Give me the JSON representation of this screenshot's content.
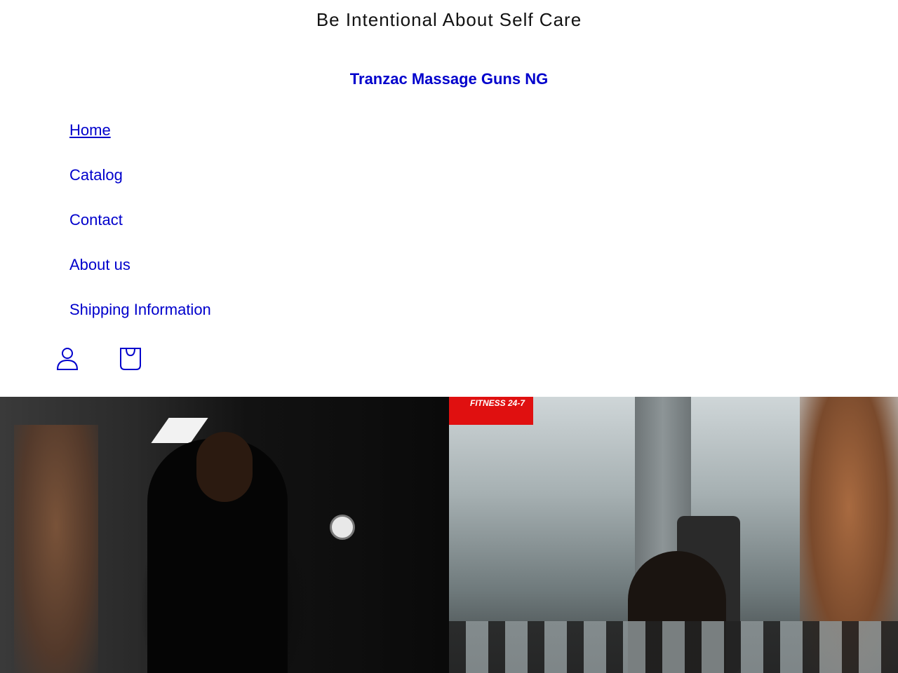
{
  "announcement": {
    "text": "Be Intentional About Self Care"
  },
  "header": {
    "site_title": "Tranzac Massage Guns NG"
  },
  "nav": {
    "items": [
      {
        "label": "Home",
        "active": true
      },
      {
        "label": "Catalog",
        "active": false
      },
      {
        "label": "Contact",
        "active": false
      },
      {
        "label": "About us",
        "active": false
      },
      {
        "label": "Shipping Information",
        "active": false
      }
    ]
  },
  "icons": {
    "account": "account-icon",
    "cart": "cart-icon"
  },
  "hero": {
    "left_sign_text": "FITNESS 24-7"
  },
  "colors": {
    "link": "#0000cc",
    "text": "#121212",
    "background": "#ffffff"
  }
}
